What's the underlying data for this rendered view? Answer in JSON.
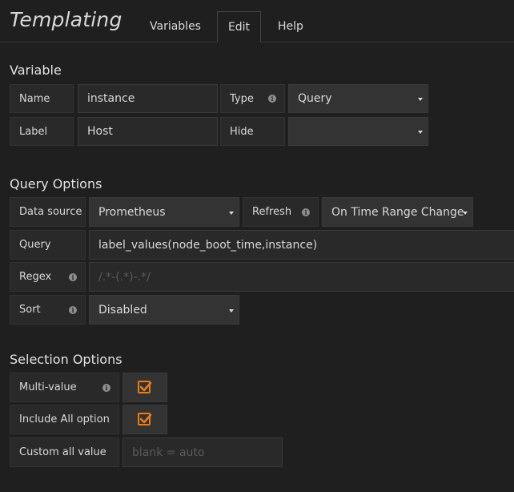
{
  "header": {
    "title": "Templating",
    "tabs": [
      {
        "label": "Variables"
      },
      {
        "label": "Edit"
      },
      {
        "label": "Help"
      }
    ]
  },
  "variable": {
    "section_title": "Variable",
    "name_label": "Name",
    "name_value": "instance",
    "type_label": "Type",
    "type_value": "Query",
    "label_label": "Label",
    "label_value": "Host",
    "hide_label": "Hide",
    "hide_value": ""
  },
  "query_options": {
    "section_title": "Query Options",
    "datasource_label": "Data source",
    "datasource_value": "Prometheus",
    "refresh_label": "Refresh",
    "refresh_value": "On Time Range Change",
    "query_label": "Query",
    "query_value": "label_values(node_boot_time,instance)",
    "regex_label": "Regex",
    "regex_placeholder": "/.*-(.*)-.*/",
    "sort_label": "Sort",
    "sort_value": "Disabled"
  },
  "selection_options": {
    "section_title": "Selection Options",
    "multi_value_label": "Multi-value",
    "multi_value_checked": true,
    "include_all_label": "Include All option",
    "include_all_checked": true,
    "custom_all_label": "Custom all value",
    "custom_all_placeholder": "blank = auto"
  },
  "colors": {
    "background": "#1f1f20",
    "checkbox_accent": "#eb7b18"
  },
  "icons": [
    "info-icon",
    "chevron-down-icon",
    "checkmark-icon"
  ]
}
